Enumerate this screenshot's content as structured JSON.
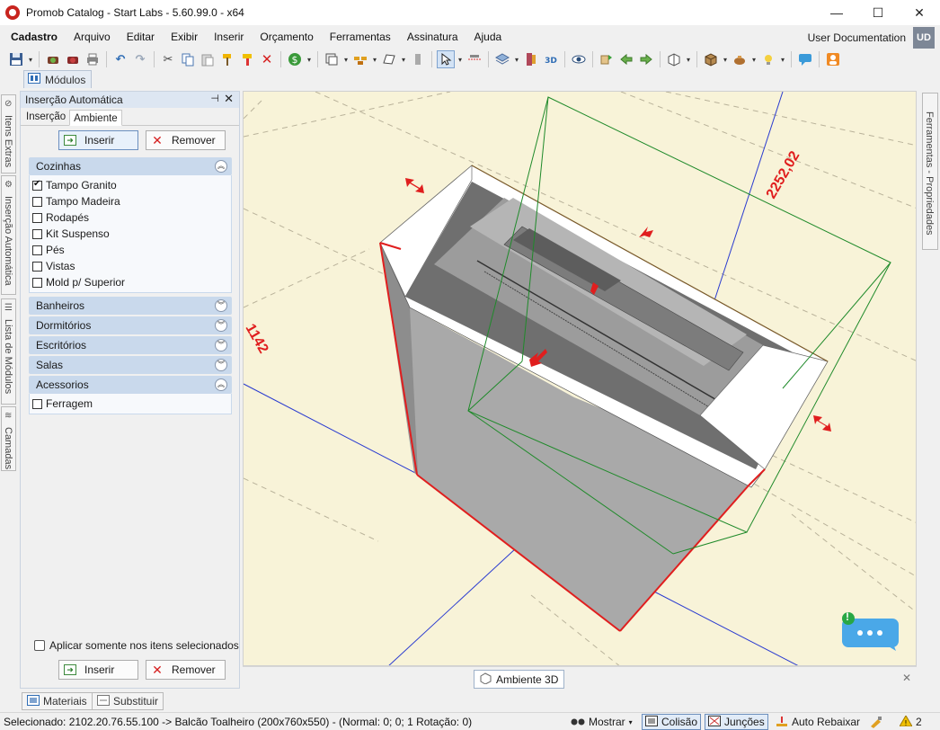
{
  "window": {
    "title": "Promob Catalog - Start Labs - 5.60.99.0 - x64",
    "minimize": "—",
    "maximize": "☐",
    "close": "✕"
  },
  "menu": {
    "items": [
      "Cadastro",
      "Arquivo",
      "Editar",
      "Exibir",
      "Inserir",
      "Orçamento",
      "Ferramentas",
      "Assinatura",
      "Ajuda"
    ],
    "user_documentation": "User Documentation",
    "user_initials": "UD"
  },
  "modules_tab": {
    "label": "Módulos"
  },
  "left_vtabs": [
    "Itens Extras",
    "Inserção Automática",
    "Lista de Módulos",
    "Camadas"
  ],
  "panel": {
    "title": "Inserção Automática",
    "tabs": [
      "Inserção",
      "Ambiente"
    ],
    "active_tab": "Ambiente",
    "insert_button": "Inserir",
    "remove_button": "Remover",
    "groups": [
      {
        "name": "Cozinhas",
        "expanded": true,
        "items": [
          {
            "label": "Tampo Granito",
            "checked": true
          },
          {
            "label": "Tampo Madeira",
            "checked": false
          },
          {
            "label": "Rodapés",
            "checked": false
          },
          {
            "label": "Kit Suspenso",
            "checked": false
          },
          {
            "label": "Pés",
            "checked": false
          },
          {
            "label": "Vistas",
            "checked": false
          },
          {
            "label": "Mold p/ Superior",
            "checked": false
          }
        ]
      },
      {
        "name": "Banheiros",
        "expanded": false
      },
      {
        "name": "Dormitórios",
        "expanded": false
      },
      {
        "name": "Escritórios",
        "expanded": false
      },
      {
        "name": "Salas",
        "expanded": false
      },
      {
        "name": "Acessorios",
        "expanded": true,
        "items": [
          {
            "label": "Ferragem",
            "checked": false
          }
        ]
      }
    ],
    "apply_selected": "Aplicar somente nos itens selecionados",
    "bottom_insert": "Inserir",
    "bottom_remove": "Remover"
  },
  "viewport": {
    "dimension_width": "2252,02",
    "dimension_depth": "1142",
    "tab_label": "Ambiente 3D",
    "close": "✕",
    "chat_badge": "!"
  },
  "right_vtab": {
    "label": "Ferramentas - Propriedades"
  },
  "bottom_tabs": [
    "Materiais",
    "Substituir"
  ],
  "status": {
    "selection": "Selecionado: 2102.20.76.55.100 -> Balcão Toalheiro (200x760x550) - (Normal: 0; 0; 1 Rotação: 0)",
    "show": "Mostrar",
    "collision": "Colisão",
    "joints": "Junções",
    "auto_lower": "Auto Rebaixar",
    "warnings": "2"
  },
  "colors": {
    "viewport_bg": "#f8f3d8",
    "accent_blue": "#6b8fbf",
    "group_header": "#c9d9ec",
    "dimension_red": "#e01e1e"
  }
}
